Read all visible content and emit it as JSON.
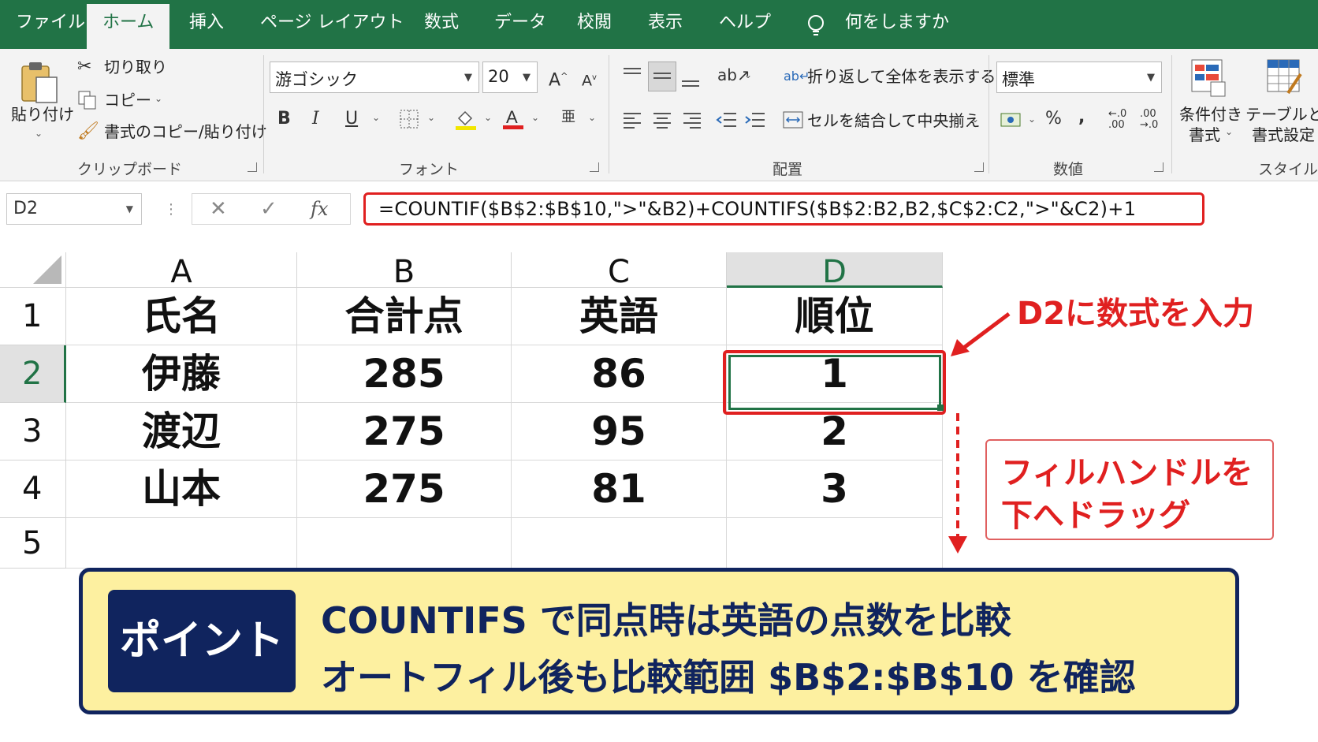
{
  "menu": {
    "tabs": [
      "ファイル",
      "ホーム",
      "挿入",
      "ページ レイアウト",
      "数式",
      "データ",
      "校閲",
      "表示",
      "ヘルプ"
    ],
    "active_tab": "ホーム",
    "tell_me": "何をしますか"
  },
  "ribbon": {
    "clipboard": {
      "paste": "貼り付け",
      "cut": "切り取り",
      "copy": "コピー",
      "format_painter": "書式のコピー/貼り付け",
      "label": "クリップボード"
    },
    "font": {
      "family": "游ゴシック",
      "size": "20",
      "label": "フォント"
    },
    "alignment": {
      "wrap_text": "折り返して全体を表示する",
      "merge_center": "セルを結合して中央揃え",
      "label": "配置"
    },
    "number": {
      "format": "標準",
      "label": "数値"
    },
    "styles": {
      "conditional_line1": "条件付き",
      "conditional_line2": "書式",
      "table_line1": "テーブルとし",
      "table_line2": "書式設定",
      "label": "スタイル"
    }
  },
  "formula_bar": {
    "name_box": "D2",
    "fx": "fx",
    "formula": "=COUNTIF($B$2:$B$10,\">\"&B2)+COUNTIFS($B$2:B2,B2,$C$2:C2,\">\"&C2)+1"
  },
  "sheet": {
    "columns": [
      "A",
      "B",
      "C",
      "D"
    ],
    "rows": [
      "1",
      "2",
      "3",
      "4",
      "5"
    ],
    "selected_column": "D",
    "selected_row": "2",
    "cells": [
      [
        "氏名",
        "合計点",
        "英語",
        "順位"
      ],
      [
        "伊藤",
        "285",
        "86",
        "1"
      ],
      [
        "渡辺",
        "275",
        "95",
        "2"
      ],
      [
        "山本",
        "275",
        "81",
        "3"
      ]
    ]
  },
  "annotations": {
    "d2_label": "D2に数式を入力",
    "fill_handle_line1": "フィルハンドルを",
    "fill_handle_line2": "下へドラッグ"
  },
  "point": {
    "badge": "ポイント",
    "line1": "COUNTIFS で同点時は英語の点数を比較",
    "line2": "オートフィル後も比較範囲 $B$2:$B$10 を確認"
  }
}
